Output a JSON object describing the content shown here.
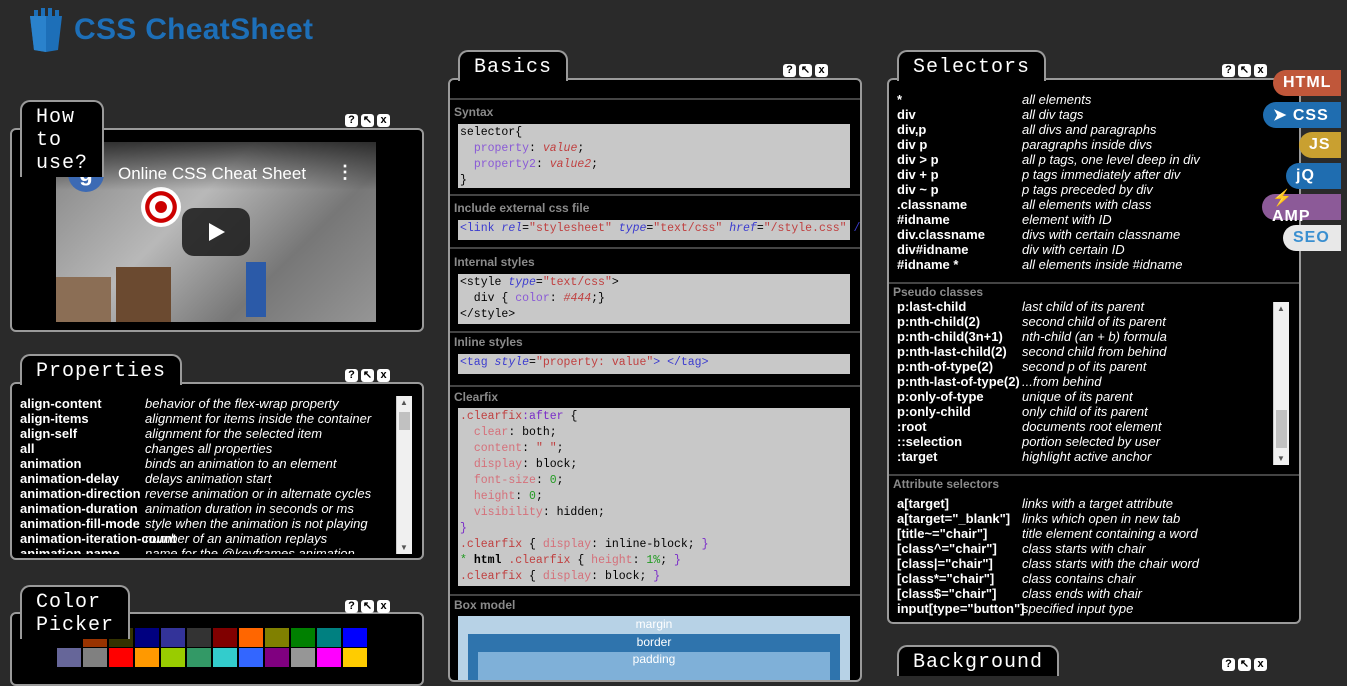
{
  "brand": {
    "title": "CSS CheatSheet",
    "icon": "css-logo-icon"
  },
  "panels": {
    "howto": {
      "title": "How to use?",
      "video_title": "Online CSS Cheat Sheet"
    },
    "properties": {
      "title": "Properties",
      "items": [
        {
          "k": "align-content",
          "v": "behavior of the flex-wrap property"
        },
        {
          "k": "align-items",
          "v": "alignment for items inside the container"
        },
        {
          "k": "align-self",
          "v": "alignment for the selected item"
        },
        {
          "k": "all",
          "v": "changes all properties"
        },
        {
          "k": "animation",
          "v": "binds an animation to an element"
        },
        {
          "k": "animation-delay",
          "v": "delays animation start"
        },
        {
          "k": "animation-direction",
          "v": "reverse animation or in alternate cycles"
        },
        {
          "k": "animation-duration",
          "v": "animation duration in seconds or ms"
        },
        {
          "k": "animation-fill-mode",
          "v": "style when the animation is not playing"
        },
        {
          "k": "animation-iteration-count",
          "v": "number of an animation replays"
        },
        {
          "k": "animation-name",
          "v": "name for the @keyframes animation"
        }
      ]
    },
    "colorpicker": {
      "title": "Color Picker",
      "row1": [
        "#000000",
        "#993300",
        "#333300",
        "#000080",
        "#333399",
        "#333333",
        "#800000",
        "#ff6600",
        "#808000",
        "#008000",
        "#008080",
        "#0000ff"
      ],
      "row2": [
        "#666699",
        "#808080",
        "#ff0000",
        "#ff9900",
        "#99cc00",
        "#339966",
        "#33cccc",
        "#3366ff",
        "#800080",
        "#969696",
        "#ff00ff",
        "#ffcc00"
      ]
    },
    "basics": {
      "title": "Basics",
      "syntax": "Syntax",
      "external": "Include external css file",
      "internal": "Internal styles",
      "inline": "Inline styles",
      "clearfix": "Clearfix",
      "boxmodel": "Box model",
      "box_margin": "margin",
      "box_border": "border",
      "box_padding": "padding"
    },
    "selectors": {
      "title": "Selectors",
      "items": [
        {
          "k": "*",
          "v": "all elements"
        },
        {
          "k": "div",
          "v": "all div tags"
        },
        {
          "k": "div,p",
          "v": "all divs and paragraphs"
        },
        {
          "k": "div p",
          "v": "paragraphs inside divs"
        },
        {
          "k": "div > p",
          "v": "all p tags, one level deep in div"
        },
        {
          "k": "div + p",
          "v": "p tags immediately after div"
        },
        {
          "k": "div ~ p",
          "v": "p tags preceded by div"
        },
        {
          "k": ".classname",
          "v": "all elements with class"
        },
        {
          "k": "#idname",
          "v": "element with ID"
        },
        {
          "k": "div.classname",
          "v": "divs with certain classname"
        },
        {
          "k": "div#idname",
          "v": "div with certain ID"
        },
        {
          "k": "#idname *",
          "v": "all elements inside #idname"
        }
      ],
      "pseudo_title": "Pseudo classes",
      "pseudo": [
        {
          "k": "p:last-child",
          "v": "last child of its parent"
        },
        {
          "k": "p:nth-child(2)",
          "v": "second child of its parent"
        },
        {
          "k": "p:nth-child(3n+1)",
          "v": "nth-child (an + b) formula"
        },
        {
          "k": "p:nth-last-child(2)",
          "v": "second child from behind"
        },
        {
          "k": "p:nth-of-type(2)",
          "v": "second p of its parent"
        },
        {
          "k": "p:nth-last-of-type(2)",
          "v": "...from behind"
        },
        {
          "k": "p:only-of-type",
          "v": "unique of its parent"
        },
        {
          "k": "p:only-child",
          "v": "only child of its parent"
        },
        {
          "k": ":root",
          "v": "documents root element"
        },
        {
          "k": "::selection",
          "v": "portion selected by user"
        },
        {
          "k": ":target",
          "v": "highlight active anchor"
        }
      ],
      "attr_title": "Attribute selectors",
      "attr": [
        {
          "k": "a[target]",
          "v": "links with a target attribute"
        },
        {
          "k": "a[target=\"_blank\"]",
          "v": "links which open in new tab"
        },
        {
          "k": "[title~=\"chair\"]",
          "v": "title element containing a word"
        },
        {
          "k": "[class^=\"chair\"]",
          "v": "class starts with chair"
        },
        {
          "k": "[class|=\"chair\"]",
          "v": "class starts with the chair word"
        },
        {
          "k": "[class*=\"chair\"]",
          "v": "class contains chair"
        },
        {
          "k": "[class$=\"chair\"]",
          "v": "class ends with chair"
        },
        {
          "k": "input[type=\"button\"]",
          "v": "specified input type"
        }
      ]
    },
    "background": {
      "title": "Background"
    }
  },
  "ctrl": {
    "help": "?",
    "expand": "↖",
    "close": "x"
  },
  "langs": [
    {
      "label": "HTML",
      "bg": "#c0573a",
      "fg": "#ffffff"
    },
    {
      "label": "➤ CSS",
      "bg": "#1f6db0",
      "fg": "#ffffff"
    },
    {
      "label": "JS",
      "bg": "#c9a030",
      "fg": "#ffffff"
    },
    {
      "label": "jQ",
      "bg": "#1f6db0",
      "fg": "#ffffff"
    },
    {
      "label": "⚡ AMP",
      "bg": "#8c5a98",
      "fg": "#ffffff"
    },
    {
      "label": "SEO",
      "bg": "#e8e8e8",
      "fg": "#3a8fd0"
    }
  ]
}
